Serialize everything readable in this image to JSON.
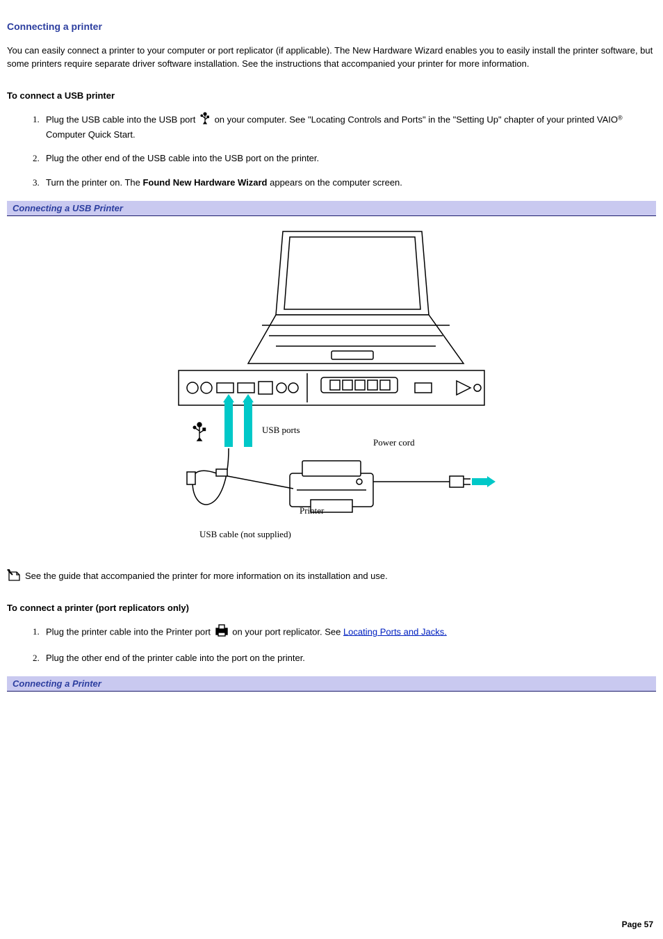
{
  "title": "Connecting a printer",
  "intro": "You can easily connect a printer to your computer or port replicator (if applicable). The New Hardware Wizard enables you to easily install the printer software, but some printers require separate driver software installation. See the instructions that accompanied your printer for more information.",
  "usb": {
    "heading": "To connect a USB printer",
    "s1a": "Plug the USB cable into the USB port ",
    "s1b": " on your computer. See \"Locating Controls and Ports\" in the \"Setting Up\" chapter of your printed VAIO",
    "s1c": " Computer Quick Start.",
    "s2": "Plug the other end of the USB cable into the USB port on the printer.",
    "s3a": "Turn the printer on. The ",
    "s3b": "Found New Hardware Wizard",
    "s3c": " appears on the computer screen."
  },
  "bar1": "Connecting a USB Printer",
  "note": "See the guide that accompanied the printer for more information on its installation and use.",
  "port": {
    "heading": "To connect a printer (port replicators only)",
    "s1a": "Plug the printer cable into the Printer port ",
    "s1b": " on your port replicator. See ",
    "s1link": "Locating Ports and Jacks.",
    "s2": "Plug the other end of the printer cable into the port on the printer."
  },
  "bar2": "Connecting a Printer",
  "labels": {
    "usbports": "USB ports",
    "power": "Power cord",
    "printer": "Printer",
    "cable": "USB cable (not supplied)"
  },
  "reg": "®",
  "page": "Page 57"
}
